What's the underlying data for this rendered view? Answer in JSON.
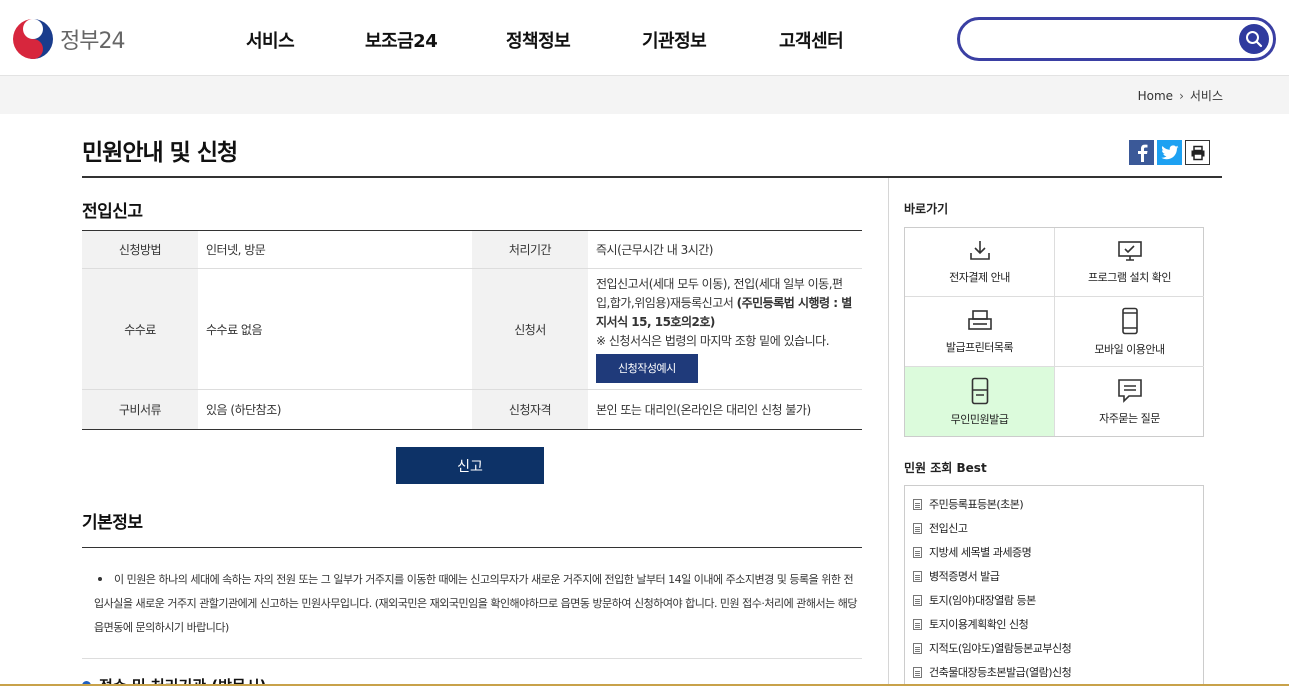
{
  "header": {
    "logo_text": "정부24",
    "nav": [
      "서비스",
      "보조금24",
      "정책정보",
      "기관정보",
      "고객센터"
    ],
    "search_placeholder": ""
  },
  "breadcrumb": [
    "Home",
    "서비스"
  ],
  "page_title": "민원안내 및 신청",
  "section_title": "전입신고",
  "info": {
    "method_label": "신청방법",
    "method_value": "인터넷, 방문",
    "period_label": "처리기간",
    "period_value": "즉시(근무시간 내 3시간)",
    "fee_label": "수수료",
    "fee_value": "수수료 없음",
    "form_label": "신청서",
    "form_value_1": "전입신고서(세대 모두 이동), 전입(세대 일부 이동,편입,합가,위임용)재등록신고서 ",
    "form_value_bold": "(주민등록법 시행령 : 별지서식 15, 15호의2호)",
    "form_note": "※ 신청서식은 법령의 마지막 조항 밑에 있습니다.",
    "sample_button": "신청작성예시",
    "docs_label": "구비서류",
    "docs_value": "있음 (하단참조)",
    "qual_label": "신청자격",
    "qual_value": "본인 또는 대리인(온라인은 대리인 신청 불가)"
  },
  "apply_button": "신고",
  "basic": {
    "title": "기본정보",
    "text": "이 민원은 하나의 세대에 속하는 자의 전원 또는 그 일부가 거주지를 이동한 때에는 신고의무자가 새로운 거주지에 전입한 날부터 14일 이내에 주소지변경 및 등록을 위한 전입사실을 새로운 거주지 관할기관에게 신고하는 민원사무입니다. (재외국민은 재외국민임을 확인해야하므로 읍면동 방문하여 신청하여야 합니다. 민원 접수·처리에 관해서는 해당 읍면동에 문의하시기 바랍니다)",
    "sub_heading": "접수 및 처리기관 (방문시)"
  },
  "sidebar": {
    "quick_title": "바로가기",
    "quick": [
      {
        "label": "전자결제 안내",
        "icon": "download-icon"
      },
      {
        "label": "프로그램 설치 확인",
        "icon": "monitor-icon"
      },
      {
        "label": "발급프린터목록",
        "icon": "printer-icon"
      },
      {
        "label": "모바일 이용안내",
        "icon": "mobile-icon"
      },
      {
        "label": "무인민원발급",
        "icon": "kiosk-icon"
      },
      {
        "label": "자주묻는 질문",
        "icon": "speech-bubble-icon"
      }
    ],
    "best_title": "민원 조회 Best",
    "best": [
      "주민등록표등본(초본)",
      "전입신고",
      "지방세 세목별 과세증명",
      "병적증명서 발급",
      "토지(임야)대장열람 등본",
      "토지이용계획확인 신청",
      "지적도(임야도)열람등본교부신청",
      "건축물대장등초본발급(열람)신청"
    ]
  }
}
